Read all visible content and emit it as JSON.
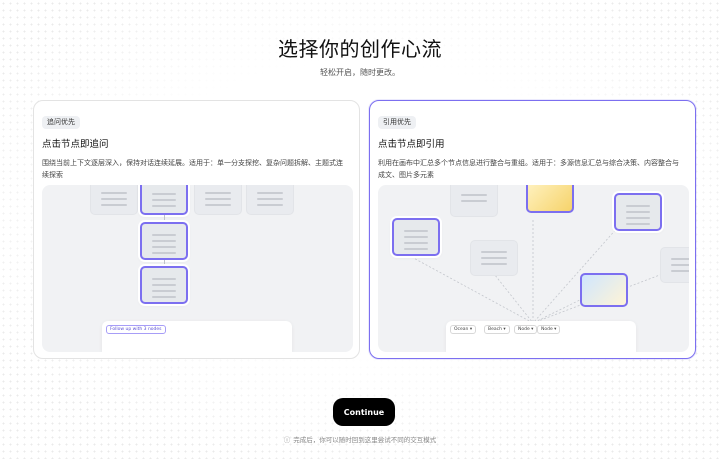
{
  "header": {
    "title": "选择你的创作心流",
    "subtitle": "轻松开启，随时更改。"
  },
  "cards": [
    {
      "badge": "追问优先",
      "title": "点击节点即追问",
      "description": "围绕当前上下文逐层深入，保持对话连续延展。适用于：单一分支探挖、复杂问题拆解、主题式连续探索",
      "preview": {
        "chip": "Follow up with 3 nodes"
      }
    },
    {
      "badge": "引用优先",
      "title": "点击节点即引用",
      "description": "利用在画布中汇总多个节点信息进行整合与重组。适用于：多源信息汇总与综合决策、内容整合与成文、图片多元素",
      "preview": {
        "chips": [
          "Ocean",
          "Beach",
          "Node",
          "Node"
        ]
      }
    }
  ],
  "footer": {
    "continue_label": "Continue",
    "hint": "完成后，你可以随时回到这里尝试不同的交互模式",
    "hint_icon": "info-icon"
  },
  "colors": {
    "accent": "#7c6ff0",
    "button": "#000000"
  }
}
